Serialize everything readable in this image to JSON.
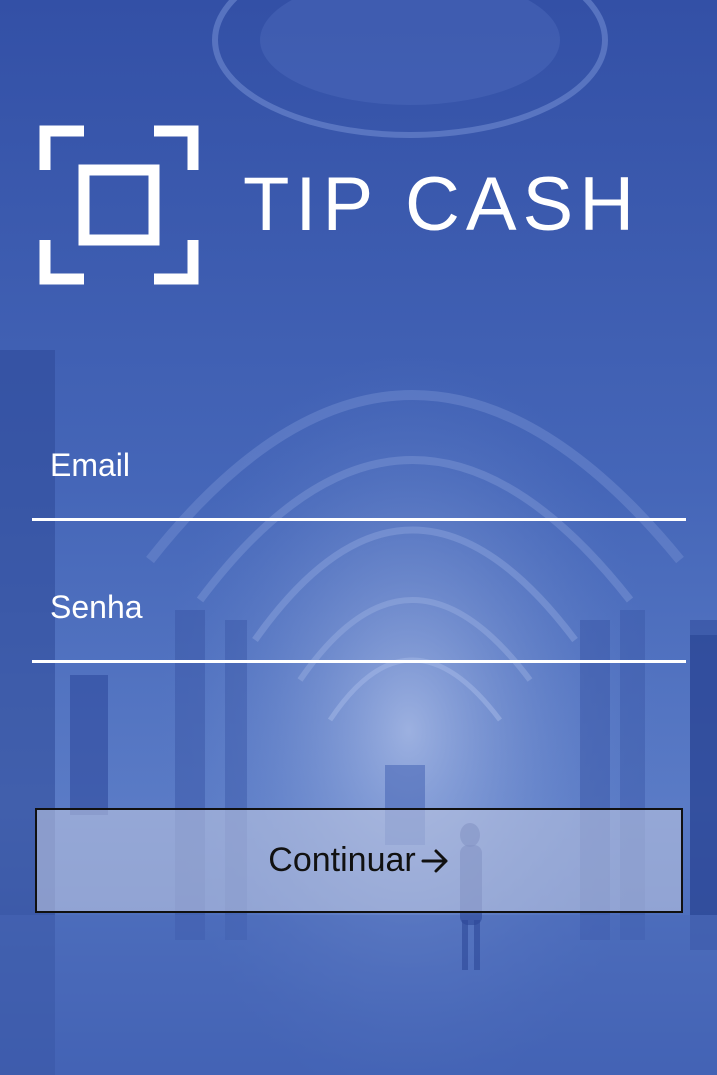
{
  "app": {
    "title": "TIP CASH",
    "logo_icon": "scan-frame-icon"
  },
  "login_form": {
    "email_placeholder": "Email",
    "password_placeholder": "Senha",
    "continue_label": "Continuar",
    "continue_icon": "arrow-right-icon"
  },
  "colors": {
    "background_tint": "#3a5ab0",
    "text": "#ffffff",
    "button_text": "#111111"
  }
}
